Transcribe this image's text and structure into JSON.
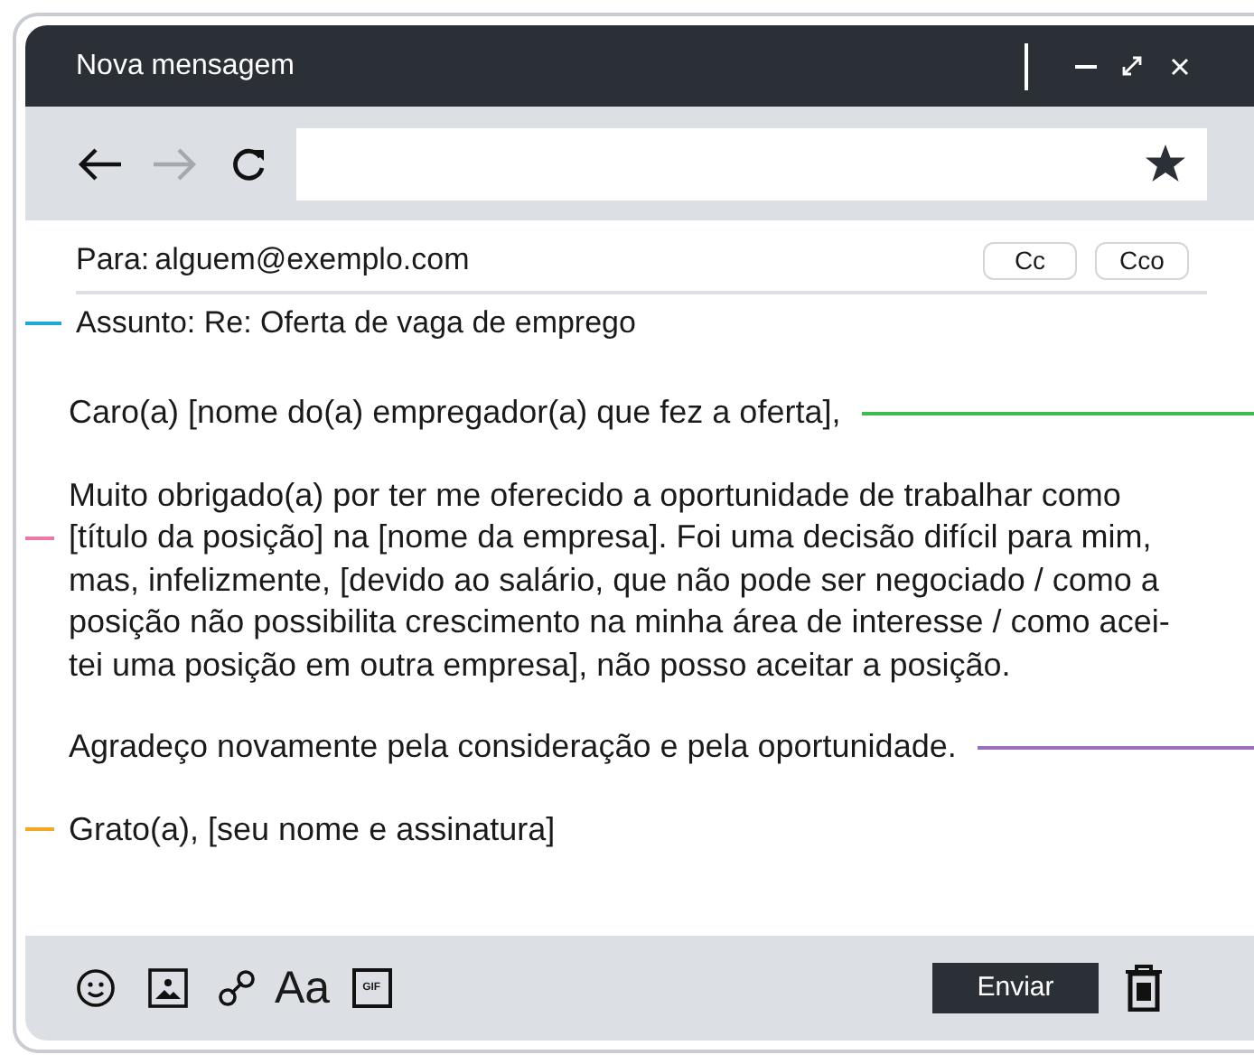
{
  "window": {
    "title": "Nova mensagem"
  },
  "toolbar": {
    "back": {
      "disabled": false
    },
    "forward": {
      "disabled": true
    }
  },
  "header": {
    "to_label": "Para:",
    "to_value": "alguem@exemplo.com",
    "cc": "Cc",
    "bcc": "Cco",
    "subject": "Assunto: Re: Oferta de vaga de emprego",
    "subject_marker": {
      "kind": "left",
      "color": "#1ea7d8"
    }
  },
  "body": [
    {
      "text": "Caro(a) [nome do(a) empregador(a) que fez a oferta],",
      "marker": {
        "kind": "right",
        "color": "#3cba54"
      }
    },
    {
      "text": "Muito obrigado(a) por ter me oferecido a oportunidade de trabalhar como\n[título da posição] na [nome da empresa]. Foi uma decisão difícil para mim,\nmas, infelizmente, [devido ao salário, que não pode ser negociado / como a\nposição não possibilita crescimento na minha área de interesse / como acei-\ntei uma posição em outra empresa], não posso aceitar a posição.",
      "marker": {
        "kind": "left",
        "color": "#e879a8"
      }
    },
    {
      "text": "Agradeço novamente pela consideração e pela oportunidade.",
      "marker": {
        "kind": "right",
        "color": "#9b6fc0"
      }
    },
    {
      "text": "Grato(a), [seu nome e assinatura]",
      "marker": {
        "kind": "left",
        "color": "#f5a623"
      }
    }
  ],
  "footer": {
    "format_label": "Aa",
    "gif_label": "GIF",
    "send": "Enviar"
  }
}
